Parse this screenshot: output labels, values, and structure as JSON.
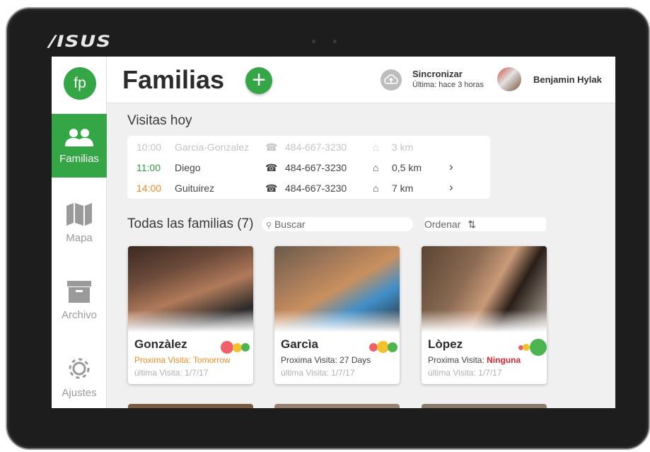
{
  "brand": "/ISUS",
  "app": {
    "logo_text": "fp",
    "title": "Familias"
  },
  "nav": [
    {
      "label": "Familias",
      "icon": "people-icon",
      "active": true
    },
    {
      "label": "Mapa",
      "icon": "map-icon",
      "active": false
    },
    {
      "label": "Archivo",
      "icon": "archive-box-icon",
      "active": false
    },
    {
      "label": "Ajustes",
      "icon": "gear-icon",
      "active": false
    }
  ],
  "sync": {
    "title": "Sincronizar",
    "subtitle": "Última: hace 3 horas",
    "icon": "cloud-upload-icon"
  },
  "user": {
    "name": "Benjamin Hylak"
  },
  "visits": {
    "title": "Visitas hoy",
    "rows": [
      {
        "time": "10:00",
        "name": "Garcia-Gonzalez",
        "phone": "484-667-3230",
        "distance": "3 km",
        "time_color": "#c4c4c4"
      },
      {
        "time": "11:00",
        "name": "Diego",
        "phone": "484-667-3230",
        "distance": "0,5 km",
        "time_color": "#2e9e3e"
      },
      {
        "time": "14:00",
        "name": "Guituirez",
        "phone": "484-667-3230",
        "distance": "7 km",
        "time_color": "#f08a24"
      }
    ]
  },
  "families": {
    "title": "Todas las familias (7)",
    "search_placeholder": "Buscar",
    "order_label": "Ordenar",
    "cards": [
      {
        "name": "Gonzàlez",
        "next_label": "Proxima Visita: Tomorrow",
        "next_value": "",
        "last": "ùltima Visita: 1/7/17",
        "next_color": "#f08a24"
      },
      {
        "name": "Garcìa",
        "next_label": "Proxima Visita: 27 Days",
        "next_value": "",
        "last": "ùltima Visita: 1/7/17",
        "next_color": "#444444"
      },
      {
        "name": "Lòpez",
        "next_label": "Proxima Visita: ",
        "next_value": "Ninguna",
        "last": "ùltima Visita: 1/7/17",
        "next_color": "#e0242f"
      }
    ]
  },
  "colors": {
    "accent": "#35a645",
    "red": "#f0606a",
    "yellow": "#f2c22e",
    "green": "#4db54f"
  }
}
